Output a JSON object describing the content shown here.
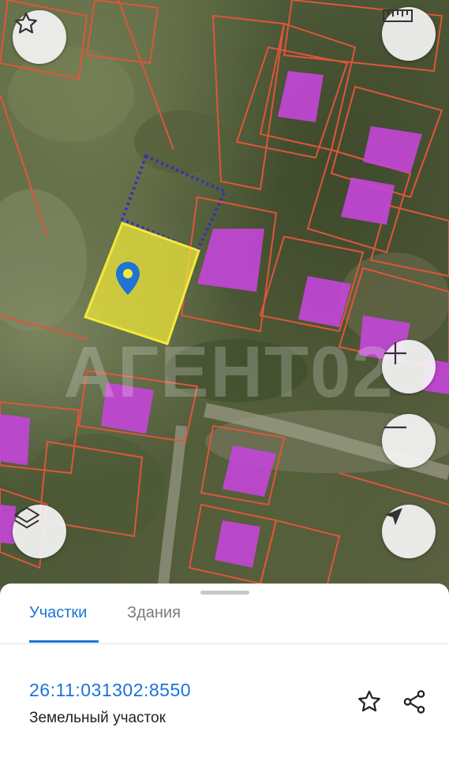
{
  "map": {
    "watermark": "АГЕНТ02",
    "buttons": {
      "favorite_icon": "star-outline",
      "ruler_icon": "ruler",
      "zoom_in_icon": "plus",
      "zoom_out_icon": "minus",
      "layers_icon": "layers",
      "locate_icon": "navigation-arrow"
    },
    "colors": {
      "parcel_border": "#e0553a",
      "building": "#c246d6",
      "selected_parcel": "#f2ea3a",
      "adjacent_outline": "#3a2fb8",
      "marker": "#1f74d6"
    }
  },
  "sheet": {
    "tabs": [
      {
        "label": "Участки",
        "active": true
      },
      {
        "label": "Здания",
        "active": false
      }
    ],
    "parcel": {
      "cadastral_number": "26:11:031302:8550",
      "type": "Земельный участок"
    },
    "actions": {
      "favorite_icon": "star-outline",
      "share_icon": "share"
    },
    "accent_color": "#1a73d9"
  }
}
